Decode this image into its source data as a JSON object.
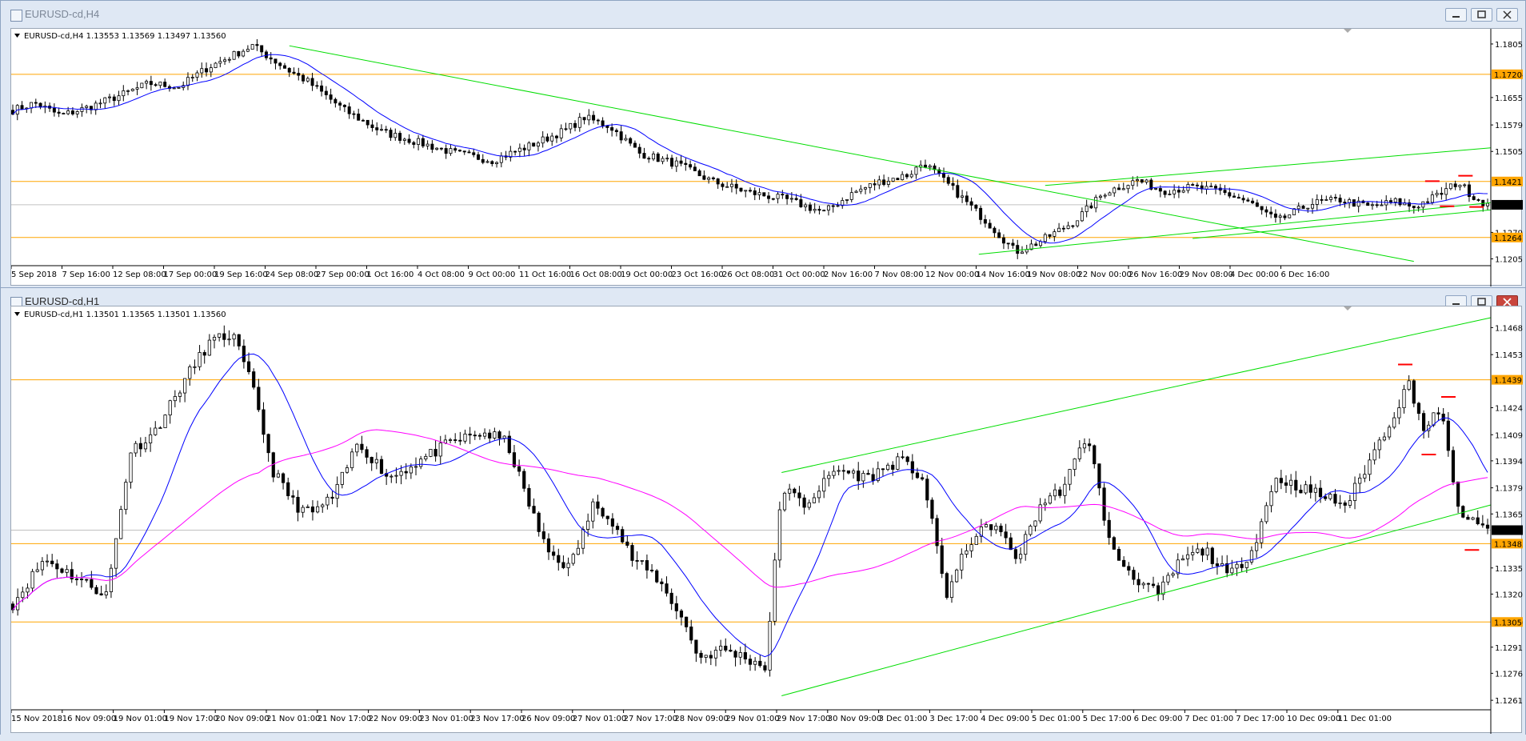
{
  "windows": [
    {
      "title": "EURUSD-cd,H4",
      "info_label": "EURUSD-cd,H4",
      "ohlc": "1.13553 1.13569 1.13497 1.13560",
      "active": false
    },
    {
      "title": "EURUSD-cd,H1",
      "info_label": "EURUSD-cd,H1",
      "ohlc": "1.13501 1.13565 1.13501 1.13560",
      "active": true
    }
  ],
  "colors": {
    "candle": "#000000",
    "ma_fast": "#0000ff",
    "ma_slow": "#ff00ff",
    "trendline": "#00dd00",
    "level": "#ffa500",
    "marker": "#ff0000",
    "price_tag_bg": "#ffa500",
    "current_tag_bg": "#000000"
  },
  "chart_data": [
    {
      "type": "candlestick",
      "symbol": "EURUSD-cd",
      "timeframe": "H4",
      "y_ticks": [
        "1.18050",
        "1.17204",
        "1.16555",
        "1.15790",
        "1.15050",
        "1.14211",
        "1.13560",
        "1.12790",
        "1.12647",
        "1.12050"
      ],
      "ylim": [
        1.1195,
        1.1825
      ],
      "x_ticks": [
        "5 Sep 2018",
        "7 Sep 16:00",
        "12 Sep 08:00",
        "17 Sep 00:00",
        "19 Sep 16:00",
        "24 Sep 08:00",
        "27 Sep 00:00",
        "1 Oct 16:00",
        "4 Oct 08:00",
        "9 Oct 00:00",
        "11 Oct 16:00",
        "16 Oct 08:00",
        "19 Oct 00:00",
        "23 Oct 16:00",
        "26 Oct 08:00",
        "31 Oct 00:00",
        "2 Nov 16:00",
        "7 Nov 08:00",
        "12 Nov 00:00",
        "14 Nov 16:00",
        "19 Nov 08:00",
        "22 Nov 00:00",
        "26 Nov 16:00",
        "29 Nov 08:00",
        "4 Dec 00:00",
        "6 Dec 16:00"
      ],
      "horizontal_levels": [
        {
          "price": 1.17204,
          "label": "1.17204"
        },
        {
          "price": 1.14211,
          "label": "1.14211"
        },
        {
          "price": 1.12647,
          "label": "1.12647"
        }
      ],
      "current_price": {
        "price": 1.1356,
        "label": "1.13560"
      },
      "close_path": [
        [
          0,
          1.162
        ],
        [
          6,
          1.164
        ],
        [
          13,
          1.1605
        ],
        [
          21,
          1.163
        ],
        [
          30,
          1.1665
        ],
        [
          37,
          1.1695
        ],
        [
          45,
          1.1685
        ],
        [
          53,
          1.174
        ],
        [
          60,
          1.1775
        ],
        [
          65,
          1.18
        ],
        [
          75,
          1.173
        ],
        [
          80,
          1.17
        ],
        [
          90,
          1.162
        ],
        [
          100,
          1.156
        ],
        [
          110,
          1.153
        ],
        [
          120,
          1.15
        ],
        [
          130,
          1.148
        ],
        [
          140,
          1.152
        ],
        [
          150,
          1.1565
        ],
        [
          155,
          1.16
        ],
        [
          162,
          1.1575
        ],
        [
          170,
          1.15
        ],
        [
          180,
          1.147
        ],
        [
          190,
          1.142
        ],
        [
          200,
          1.139
        ],
        [
          210,
          1.137
        ],
        [
          220,
          1.1335
        ],
        [
          228,
          1.139
        ],
        [
          235,
          1.142
        ],
        [
          243,
          1.144
        ],
        [
          247,
          1.1475
        ],
        [
          255,
          1.14
        ],
        [
          265,
          1.13
        ],
        [
          272,
          1.1225
        ],
        [
          278,
          1.125
        ],
        [
          288,
          1.131
        ],
        [
          296,
          1.139
        ],
        [
          305,
          1.1425
        ],
        [
          312,
          1.1395
        ],
        [
          320,
          1.1405
        ],
        [
          327,
          1.1395
        ],
        [
          335,
          1.1365
        ],
        [
          343,
          1.131
        ],
        [
          352,
          1.136
        ],
        [
          360,
          1.137
        ],
        [
          368,
          1.135
        ],
        [
          375,
          1.1365
        ],
        [
          380,
          1.135
        ],
        [
          387,
          1.1385
        ],
        [
          392,
          1.142
        ],
        [
          396,
          1.138
        ],
        [
          400,
          1.1356
        ]
      ],
      "ma_period_visual": "blue",
      "trendlines": [
        {
          "from": [
            75,
            1.18
          ],
          "to": [
            380,
            1.1198
          ]
        },
        {
          "from": [
            262,
            1.1218
          ],
          "to": [
            420,
            1.1362
          ]
        },
        {
          "from": [
            320,
            1.1262
          ],
          "to": [
            420,
            1.1342
          ]
        },
        {
          "from": [
            280,
            1.141
          ],
          "to": [
            420,
            1.1515
          ]
        }
      ],
      "markers": [
        {
          "x": 385,
          "price": 1.1422
        },
        {
          "x": 394,
          "price": 1.1437
        },
        {
          "x": 389,
          "price": 1.1352
        },
        {
          "x": 397,
          "price": 1.135
        }
      ]
    },
    {
      "type": "candlestick",
      "symbol": "EURUSD-cd",
      "timeframe": "H1",
      "y_ticks": [
        "1.14685",
        "1.14535",
        "1.14395",
        "1.14240",
        "1.14090",
        "1.13945",
        "1.13795",
        "1.13650",
        "1.13560",
        "1.13485",
        "1.13350",
        "1.13205",
        "1.13050",
        "1.12910",
        "1.12765",
        "1.12615"
      ],
      "ylim": [
        1.1258,
        1.1474
      ],
      "x_ticks": [
        "15 Nov 2018",
        "16 Nov 09:00",
        "19 Nov 01:00",
        "19 Nov 17:00",
        "20 Nov 09:00",
        "21 Nov 01:00",
        "21 Nov 17:00",
        "22 Nov 09:00",
        "23 Nov 01:00",
        "23 Nov 17:00",
        "26 Nov 09:00",
        "27 Nov 01:00",
        "27 Nov 17:00",
        "28 Nov 09:00",
        "29 Nov 01:00",
        "29 Nov 17:00",
        "30 Nov 09:00",
        "3 Dec 01:00",
        "3 Dec 17:00",
        "4 Dec 09:00",
        "5 Dec 01:00",
        "5 Dec 17:00",
        "6 Dec 09:00",
        "7 Dec 01:00",
        "7 Dec 17:00",
        "10 Dec 09:00",
        "11 Dec 01:00"
      ],
      "horizontal_levels": [
        {
          "price": 1.14395,
          "label": "1.14395"
        },
        {
          "price": 1.13485,
          "label": "1.13485"
        },
        {
          "price": 1.1305,
          "label": "1.13050"
        }
      ],
      "current_price": {
        "price": 1.1356,
        "label": "1.13560"
      },
      "close_path": [
        [
          0,
          1.1315
        ],
        [
          8,
          1.134
        ],
        [
          16,
          1.133
        ],
        [
          24,
          1.132
        ],
        [
          30,
          1.14
        ],
        [
          36,
          1.141
        ],
        [
          44,
          1.144
        ],
        [
          50,
          1.146
        ],
        [
          56,
          1.1465
        ],
        [
          62,
          1.143
        ],
        [
          66,
          1.139
        ],
        [
          72,
          1.137
        ],
        [
          76,
          1.1365
        ],
        [
          82,
          1.1375
        ],
        [
          88,
          1.1405
        ],
        [
          96,
          1.1385
        ],
        [
          104,
          1.1395
        ],
        [
          112,
          1.1405
        ],
        [
          120,
          1.141
        ],
        [
          126,
          1.1405
        ],
        [
          130,
          1.138
        ],
        [
          136,
          1.1345
        ],
        [
          142,
          1.1335
        ],
        [
          148,
          1.137
        ],
        [
          152,
          1.1365
        ],
        [
          158,
          1.134
        ],
        [
          164,
          1.133
        ],
        [
          170,
          1.131
        ],
        [
          175,
          1.1285
        ],
        [
          181,
          1.129
        ],
        [
          187,
          1.1285
        ],
        [
          192,
          1.128
        ],
        [
          196,
          1.138
        ],
        [
          202,
          1.137
        ],
        [
          210,
          1.139
        ],
        [
          218,
          1.1385
        ],
        [
          226,
          1.1395
        ],
        [
          232,
          1.1385
        ],
        [
          238,
          1.132
        ],
        [
          244,
          1.135
        ],
        [
          250,
          1.136
        ],
        [
          256,
          1.134
        ],
        [
          262,
          1.137
        ],
        [
          268,
          1.138
        ],
        [
          274,
          1.141
        ],
        [
          280,
          1.1345
        ],
        [
          286,
          1.133
        ],
        [
          292,
          1.132
        ],
        [
          298,
          1.134
        ],
        [
          304,
          1.1345
        ],
        [
          310,
          1.133
        ],
        [
          316,
          1.1345
        ],
        [
          322,
          1.1385
        ],
        [
          328,
          1.138
        ],
        [
          334,
          1.1375
        ],
        [
          340,
          1.137
        ],
        [
          346,
          1.1395
        ],
        [
          352,
          1.142
        ],
        [
          356,
          1.1438
        ],
        [
          360,
          1.141
        ],
        [
          364,
          1.1425
        ],
        [
          368,
          1.137
        ],
        [
          372,
          1.136
        ],
        [
          376,
          1.1356
        ]
      ],
      "ma_fast": "blue",
      "ma_slow": "magenta",
      "trendlines": [
        {
          "from": [
            196,
            1.1264
          ],
          "to": [
            420,
            1.137
          ]
        },
        {
          "from": [
            196,
            1.1388
          ],
          "to": [
            420,
            1.1474
          ]
        }
      ],
      "markers": [
        {
          "x": 355,
          "price": 1.1448
        },
        {
          "x": 366,
          "price": 1.143
        },
        {
          "x": 361,
          "price": 1.1398
        },
        {
          "x": 372,
          "price": 1.1345
        }
      ]
    }
  ]
}
